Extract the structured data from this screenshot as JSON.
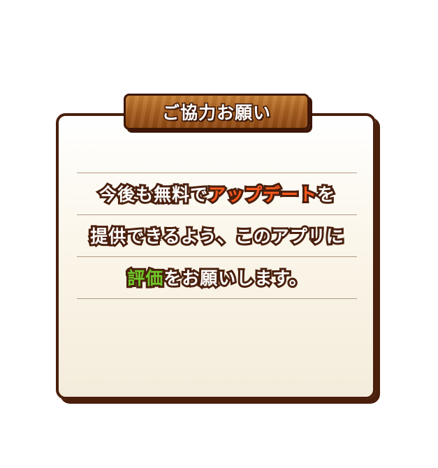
{
  "dialog": {
    "title": "ご協力お願い",
    "message": {
      "line1": {
        "before": "今後も無料で",
        "highlight": "アップデート",
        "after": "を"
      },
      "line2": "提供できるよう、このアプリに",
      "line3": {
        "highlight": "評価",
        "after": "をお願いします。"
      }
    }
  },
  "colors": {
    "frame_border": "#4a1f0c",
    "title_plate": "#a45b1e",
    "highlight_orange": "#ff5a1e",
    "highlight_green": "#6fc92a",
    "text_fill": "#ffffff"
  }
}
